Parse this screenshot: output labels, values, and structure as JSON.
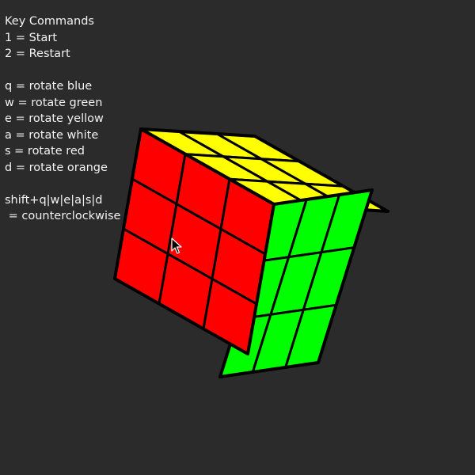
{
  "help": {
    "title": "Key Commands",
    "start": "1 = Start",
    "restart": "2 = Restart",
    "rotations": [
      "q = rotate blue",
      "w = rotate green",
      "e = rotate yellow",
      "a = rotate white",
      "s = rotate red",
      "d = rotate orange"
    ],
    "modifier": "shift+q|w|e|a|s|d",
    "modifier_meaning": " = counterclockwise"
  },
  "cube": {
    "faces": {
      "front": {
        "color": "#ff0000"
      },
      "right": {
        "color": "#00ff00"
      },
      "top": {
        "color": "#ffff00"
      }
    },
    "edge_color": "#000000"
  },
  "colors": {
    "background": "#2b2b2b",
    "text": "#f2f2f2"
  }
}
